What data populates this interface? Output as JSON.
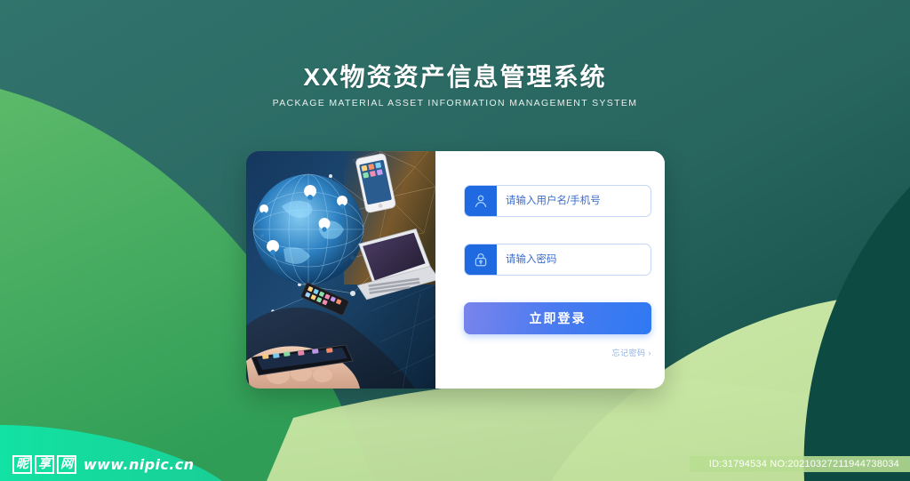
{
  "page": {
    "title_cn": "XX物资资产信息管理系统",
    "subtitle_en": "PACKAGE MATERIAL ASSET INFORMATION MANAGEMENT SYSTEM",
    "background_color": "#2b6e69",
    "accent_color": "#2f79f2",
    "green_light": "#c3e29a",
    "green_mid": "#3faa5c",
    "green_dark": "#0d4a42",
    "green_mint": "#16d89a"
  },
  "card": {
    "visual_alt": "technology-network-illustration"
  },
  "form": {
    "username": {
      "placeholder": "请输入用户名/手机号",
      "value": "",
      "icon": "user-icon"
    },
    "password": {
      "placeholder": "请输入密码",
      "value": "",
      "icon": "lock-icon"
    },
    "submit_label": "立即登录",
    "forgot_label": "忘记密码",
    "forgot_chevron": "›"
  },
  "watermark": {
    "logo_chars": [
      "昵",
      "享",
      "网"
    ],
    "url": "www.nipic.cn",
    "id_text": "ID:31794534 NO:20210327211944738034"
  }
}
